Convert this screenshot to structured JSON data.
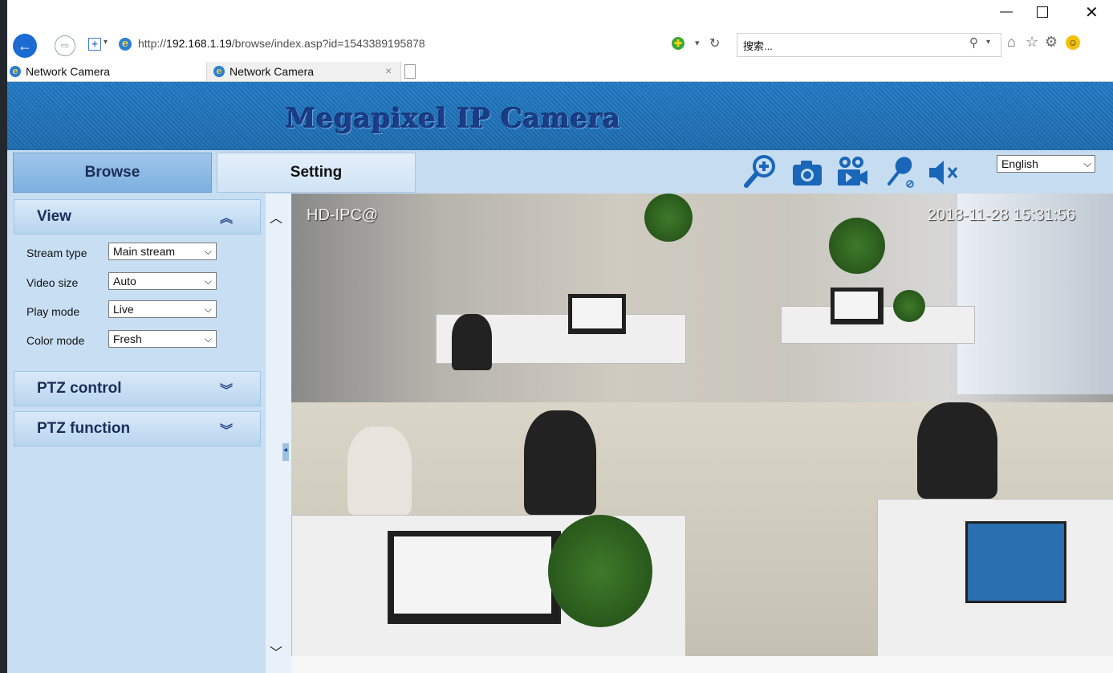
{
  "browser": {
    "url_prefix": "http://",
    "url_host": "192.168.1.19",
    "url_path": "/browse/index.asp?id=1543389195878",
    "search_placeholder": "搜索...",
    "tabs": [
      {
        "label": "Network Camera"
      },
      {
        "label": "Network Camera"
      }
    ]
  },
  "banner": {
    "title": "Megapixel IP Camera"
  },
  "nav": {
    "browse_label": "Browse",
    "setting_label": "Setting",
    "language": "English",
    "toolbar_icons": [
      "zoom-in-icon",
      "snapshot-camera-icon",
      "record-video-icon",
      "microphone-icon",
      "mute-speaker-icon"
    ]
  },
  "sidebar": {
    "view": {
      "title": "View",
      "fields": [
        {
          "label": "Stream type",
          "value": "Main stream"
        },
        {
          "label": "Video size",
          "value": "Auto"
        },
        {
          "label": "Play mode",
          "value": "Live"
        },
        {
          "label": "Color mode",
          "value": "Fresh"
        }
      ]
    },
    "ptz_control": {
      "title": "PTZ control"
    },
    "ptz_function": {
      "title": "PTZ function"
    }
  },
  "video": {
    "label": "HD-IPC@",
    "timestamp": "2018-11-28  15:31:56"
  },
  "colors": {
    "banner_blue": "#1f78c3",
    "title_navy": "#1c3d86",
    "toolbar_icon": "#1a66b8",
    "sidebar_bg": "#c8dff3"
  }
}
